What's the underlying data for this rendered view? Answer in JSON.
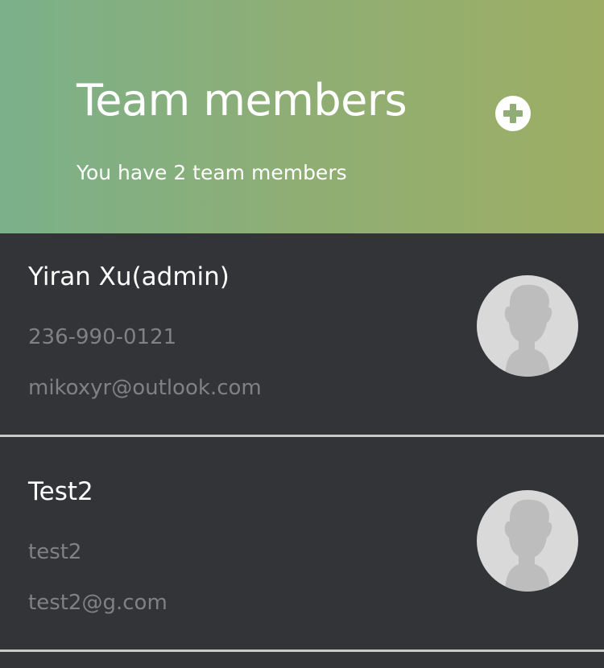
{
  "header": {
    "title": "Team members",
    "subtitle": "You have 2 team members"
  },
  "actions": {
    "add_icon": "plus-circle-icon"
  },
  "members": [
    {
      "name": "Yiran Xu(admin)",
      "phone": "236-990-0121",
      "email": "mikoxyr@outlook.com",
      "avatar_icon": "user-silhouette-icon"
    },
    {
      "name": "Test2",
      "phone": "test2",
      "email": "test2@g.com",
      "avatar_icon": "user-silhouette-icon"
    }
  ],
  "colors": {
    "header_gradient_start": "#7bb08a",
    "header_gradient_end": "#9dae64",
    "card_background": "#333438",
    "primary_text": "#ffffff",
    "secondary_text": "#808185",
    "divider": "#c9c9c9",
    "avatar_background": "#d9d9d9",
    "avatar_silhouette": "#bdbdbd"
  }
}
